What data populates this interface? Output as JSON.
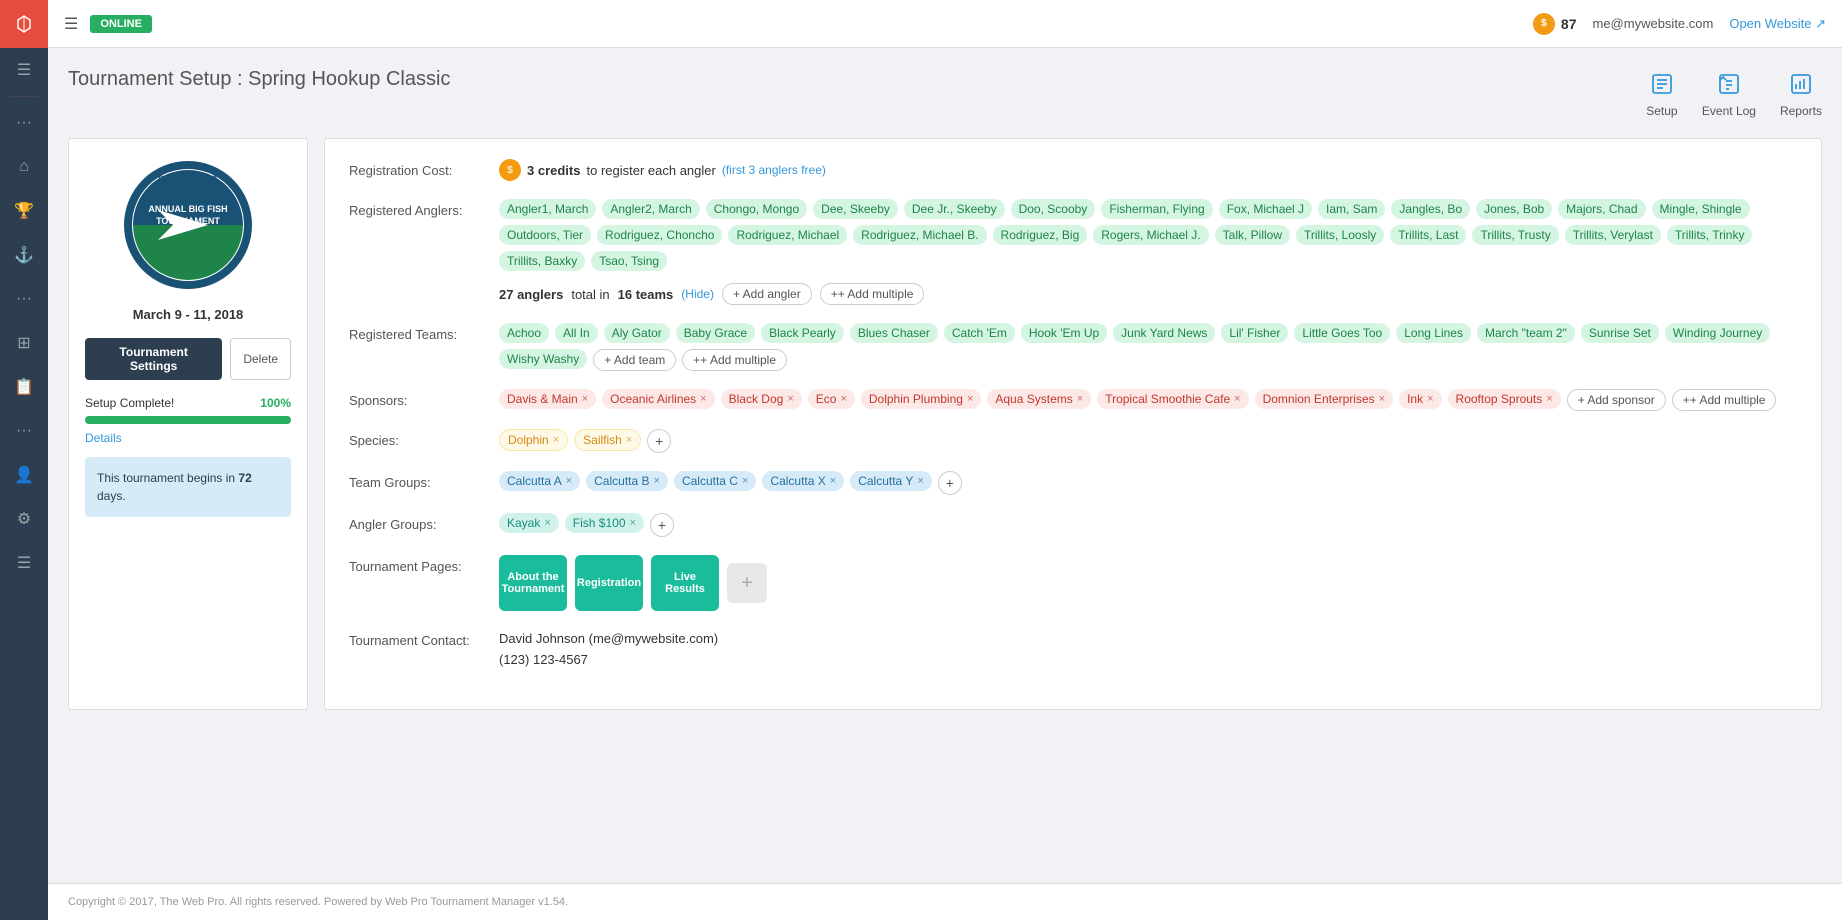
{
  "topbar": {
    "menu_icon": "☰",
    "online_label": "ONLINE",
    "credits_count": "87",
    "email": "me@mywebsite.com",
    "open_website_label": "Open Website ↗"
  },
  "header": {
    "title": "Tournament Setup",
    "subtitle": ": Spring Hookup Classic",
    "setup_label": "Setup",
    "event_log_label": "Event Log",
    "reports_label": "Reports"
  },
  "left_panel": {
    "date": "March 9 - 11, 2018",
    "tournament_settings_label": "Tournament Settings",
    "delete_label": "Delete",
    "setup_complete_label": "Setup Complete!",
    "setup_percent": "100%",
    "details_label": "Details",
    "info_box_text": "This tournament begins in ",
    "info_box_days": "72",
    "info_box_suffix": " days."
  },
  "right_panel": {
    "reg_cost_label": "Registration Cost:",
    "reg_cost_credits": "3 credits",
    "reg_cost_desc": "to register each angler",
    "reg_cost_free": "(first 3 anglers free)",
    "registered_anglers_label": "Registered Anglers:",
    "anglers": [
      "Angler1, March",
      "Angler2, March",
      "Chongo, Mongo",
      "Dee, Skeeby",
      "Dee Jr., Skeeby",
      "Doo, Scooby",
      "Fisherman, Flying",
      "Fox, Michael J",
      "Iam, Sam",
      "Jangles, Bo",
      "Jones, Bob",
      "Majors, Chad",
      "Mingle, Shingle",
      "Outdoors, Tier",
      "Rodriguez, Choncho",
      "Rodriguez, Michael",
      "Rodriguez, Michael B.",
      "Rodriguez, Big",
      "Rogers, Michael J.",
      "Talk, Pillow",
      "Trillits, Loosly",
      "Trillits, Last",
      "Trillits, Trusty",
      "Trillits, Verylast",
      "Trillits, Trinky",
      "Trillits, Baxky",
      "Tsao, Tsing"
    ],
    "anglers_count_text": "27 anglers",
    "anglers_total_text": "total in",
    "teams_count_text": "16 teams",
    "hide_label": "Hide",
    "add_angler_label": "+ Add angler",
    "add_multiple_label": "++ Add multiple",
    "registered_teams_label": "Registered Teams:",
    "teams": [
      "Achoo",
      "All In",
      "Aly Gator",
      "Baby Grace",
      "Black Pearly",
      "Blues Chaser",
      "Catch 'Em",
      "Hook 'Em Up",
      "Junk Yard News",
      "Lil' Fisher",
      "Little Goes Too",
      "Long Lines",
      "March \"team 2\"",
      "Sunrise Set",
      "Winding Journey",
      "Wishy Washy"
    ],
    "add_team_label": "+ Add team",
    "add_team_multiple_label": "++ Add multiple",
    "sponsors_label": "Sponsors:",
    "sponsors": [
      "Davis & Main",
      "Oceanic Airlines",
      "Black Dog",
      "Eco",
      "Dolphin Plumbing",
      "Aqua Systems",
      "Tropical Smoothie Cafe",
      "Domnion Enterprises",
      "Ink",
      "Rooftop Sprouts"
    ],
    "add_sponsor_label": "+ Add sponsor",
    "add_sponsor_multiple_label": "++ Add multiple",
    "species_label": "Species:",
    "species": [
      "Dolphin",
      "Sailfish"
    ],
    "team_groups_label": "Team Groups:",
    "team_groups": [
      "Calcutta A",
      "Calcutta B",
      "Calcutta C",
      "Calcutta X",
      "Calcutta Y"
    ],
    "angler_groups_label": "Angler Groups:",
    "angler_groups": [
      "Kayak",
      "Fish $100"
    ],
    "tournament_pages_label": "Tournament Pages:",
    "pages": [
      {
        "label": "About the Tournament"
      },
      {
        "label": "Registration"
      },
      {
        "label": "Live Results"
      }
    ],
    "tournament_contact_label": "Tournament Contact:",
    "contact_name": "David Johnson (me@mywebsite.com)",
    "contact_phone": "(123) 123-4567"
  },
  "sidebar": {
    "items": [
      {
        "icon": "✕",
        "name": "close"
      },
      {
        "icon": "⋯",
        "name": "dots1"
      },
      {
        "icon": "⌂",
        "name": "home"
      },
      {
        "icon": "🏆",
        "name": "trophy"
      },
      {
        "icon": "⚓",
        "name": "anchor"
      },
      {
        "icon": "⋯",
        "name": "dots2"
      },
      {
        "icon": "◧",
        "name": "layers"
      },
      {
        "icon": "📋",
        "name": "clipboard"
      },
      {
        "icon": "⋯",
        "name": "dots3"
      },
      {
        "icon": "👤",
        "name": "user"
      },
      {
        "icon": "⚙",
        "name": "settings"
      },
      {
        "icon": "☰",
        "name": "menu"
      }
    ]
  },
  "footer": {
    "text": "Copyright © 2017, The Web Pro. All rights reserved. Powered by Web Pro Tournament Manager v1.54."
  }
}
